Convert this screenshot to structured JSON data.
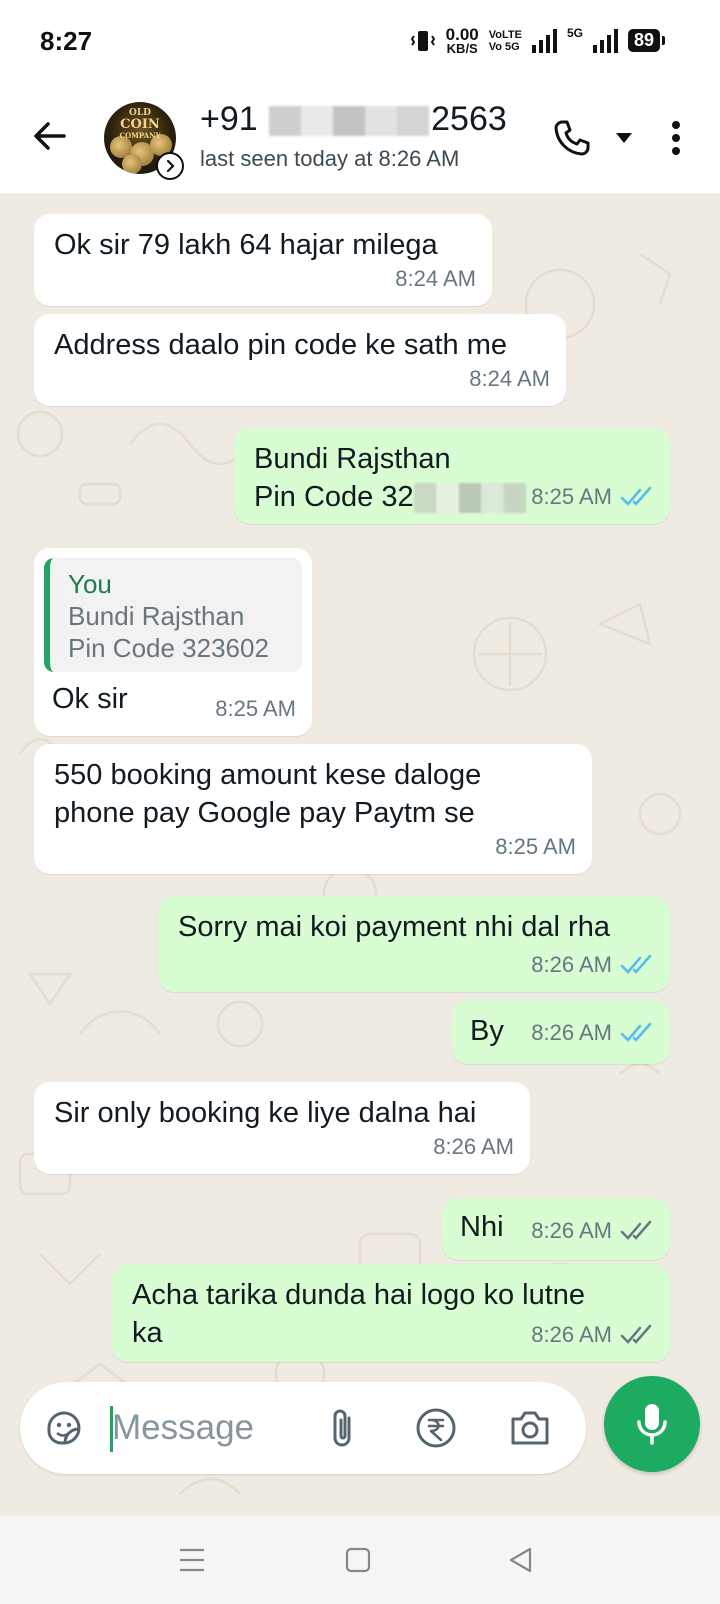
{
  "status_bar": {
    "time": "8:27",
    "net_speed": "0.00",
    "net_unit": "KB/S",
    "volte_top": "VoLTE",
    "volte_bottom": "Vo 5G",
    "network": "5G",
    "battery": "89"
  },
  "header": {
    "avatar_text_top": "OLD",
    "avatar_text_mid": "COIN",
    "avatar_text_bottom": "COMPANY",
    "contact_prefix": "+91",
    "contact_suffix": "2563",
    "last_seen": "last seen today at 8:26 AM"
  },
  "messages": [
    {
      "dir": "in",
      "text": "Ok sir 79 lakh 64 hajar milega",
      "time": "8:24 AM"
    },
    {
      "dir": "in",
      "text": "Address daalo pin code ke sath me",
      "time": "8:24 AM"
    },
    {
      "dir": "out",
      "text_line1": "Bundi Rajsthan",
      "text_line2_prefix": "Pin Code 32",
      "time": "8:25 AM",
      "status": "read"
    },
    {
      "dir": "in",
      "quote_author": "You",
      "quote_text": "Bundi Rajsthan\nPin Code 323602",
      "text": "Ok sir",
      "time": "8:25 AM"
    },
    {
      "dir": "in",
      "text": "550 booking amount kese daloge\nphone pay Google pay Paytm se",
      "time": "8:25 AM"
    },
    {
      "dir": "out",
      "text": "Sorry mai koi payment nhi dal rha",
      "time": "8:26 AM",
      "status": "read"
    },
    {
      "dir": "out",
      "text": "By",
      "time": "8:26 AM",
      "status": "read"
    },
    {
      "dir": "in",
      "text": "Sir only booking ke liye dalna hai",
      "time": "8:26 AM"
    },
    {
      "dir": "out",
      "text": "Nhi",
      "time": "8:26 AM",
      "status": "delivered"
    },
    {
      "dir": "out",
      "text": "Acha tarika dunda hai logo ko lutne\nka",
      "time": "8:26 AM",
      "status": "delivered"
    }
  ],
  "composer": {
    "placeholder": "Message"
  },
  "colors": {
    "incoming_bubble": "#ffffff",
    "outgoing_bubble": "#d9fdd3",
    "chat_background": "#efeae2",
    "read_tick": "#53bdeb",
    "delivered_tick": "#667781",
    "accent_green": "#1daa61"
  },
  "icons": {
    "back": "arrow-left-icon",
    "status_badge": "chevron-right-circle-icon",
    "call": "phone-icon",
    "call_options": "caret-down-icon",
    "menu": "more-vertical-icon",
    "sticker": "sticker-icon",
    "attach": "paperclip-icon",
    "payment": "rupee-icon",
    "camera": "camera-icon",
    "mic": "microphone-icon",
    "nav_menu": "nav-menu-icon",
    "nav_home": "nav-home-icon",
    "nav_back": "nav-back-icon"
  }
}
